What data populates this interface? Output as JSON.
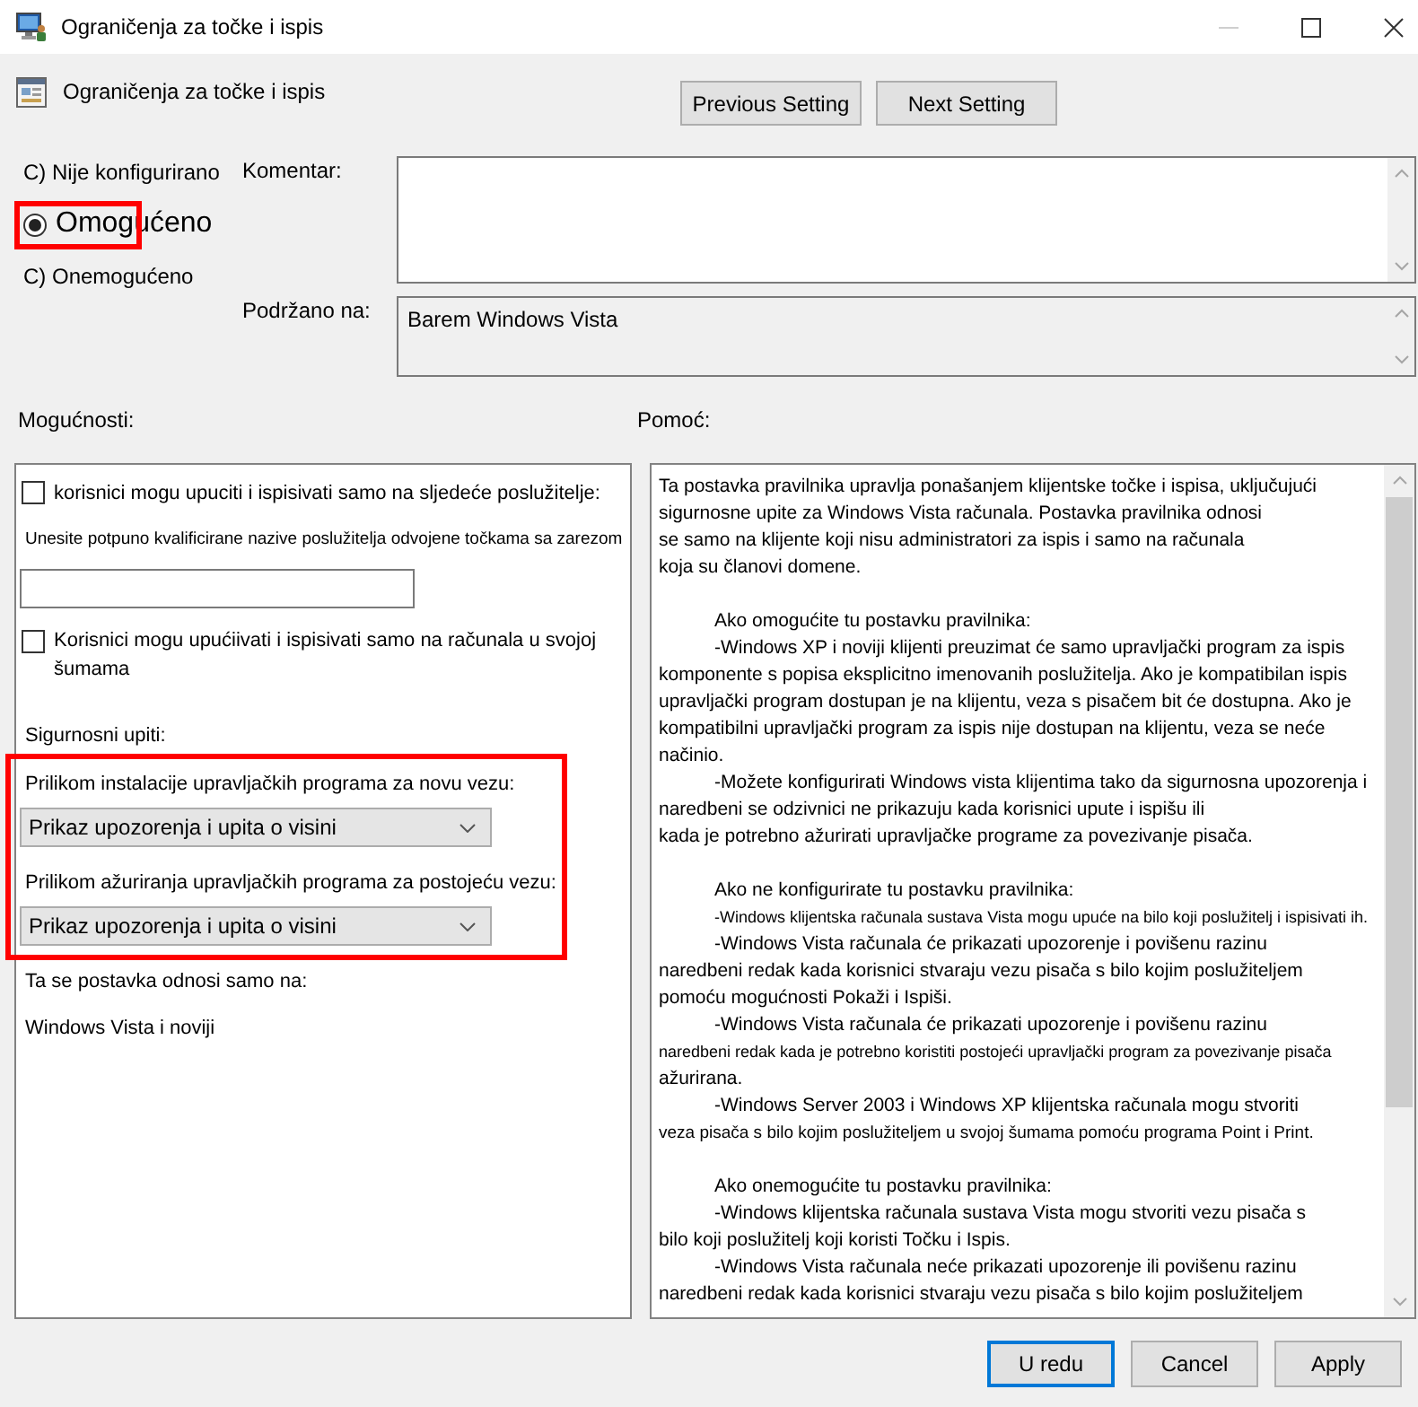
{
  "window": {
    "title": "Ograničenja za točke i ispis"
  },
  "header": {
    "title": "Ograničenja za točke i ispis",
    "nav_buttons": [
      {
        "label": "Previous Setting"
      },
      {
        "label": "Next Setting"
      }
    ]
  },
  "state_options": [
    {
      "label": "C) Nije konfigurirano",
      "selected": false,
      "highlighted": false
    },
    {
      "label": "Omogućeno",
      "selected": true,
      "highlighted": true
    },
    {
      "label": "C) Onemogućeno",
      "selected": false,
      "highlighted": false
    }
  ],
  "comment": {
    "label": "Komentar:"
  },
  "supported": {
    "label": "Podržano na:",
    "value": "Barem Windows Vista"
  },
  "options": {
    "title": "Mogućnosti:",
    "allowed_servers": {
      "label": "korisnici mogu upuciti i ispisivati samo na sljedeće poslužitelje:",
      "checked": false,
      "hint": "Unesite potpuno kvalificirane nazive poslužitelja odvojene točkama sa zarezom"
    },
    "forest_only": {
      "label": "Korisnici mogu upućiivati i ispisivati samo na računala u svojoj šumama",
      "checked": false
    },
    "security_prompts": {
      "title": "Sigurnosni upiti:",
      "highlighted": true,
      "fields": [
        {
          "label": "Prilikom instalacije upravljačkih programa za novu vezu:",
          "value": "Prikaz upozorenja i upita o visini"
        },
        {
          "label": "Prilikom ažuriranja upravljačkih programa za postojeću vezu:",
          "value": "Prikaz upozorenja i upita o visini"
        }
      ]
    },
    "applies_to": {
      "label": "Ta se postavka odnosi samo na:",
      "value": "Windows Vista i noviji"
    }
  },
  "help": {
    "title": "Pomoć:",
    "sections": [
      {
        "items": [
          {
            "indented": false,
            "lines": [
              {
                "text": "Ta postavka pravilnika upravlja ponašanjem klijentske točke i ispisa, uključujući",
                "kind": "normal"
              },
              {
                "text": "sigurnosne upite za Windows Vista računala. Postavka pravilnika odnosi",
                "kind": "normal"
              },
              {
                "text": "se samo na klijente koji nisu administratori za ispis i samo na računala",
                "kind": "normal"
              },
              {
                "text": "koja su članovi domene.",
                "kind": "normal"
              }
            ]
          }
        ]
      },
      {
        "items": [
          {
            "indented": true,
            "lines": [
              {
                "text": "Ako omogućite tu postavku pravilnika:",
                "kind": "normal"
              }
            ]
          },
          {
            "indented": true,
            "lines": [
              {
                "text": "-Windows XP i noviji klijenti preuzimat će samo upravljački program za ispis",
                "kind": "normal"
              },
              {
                "text": "komponente s popisa eksplicitno imenovanih poslužitelja. Ako je kompatibilan ispis",
                "kind": "normal"
              },
              {
                "text": "upravljački program dostupan je na klijentu, veza s pisačem bit će dostupna. Ako je",
                "kind": "normal"
              },
              {
                "text": "kompatibilni upravljački program za ispis nije dostupan na klijentu, veza se neće",
                "kind": "normal"
              },
              {
                "text": "načinio.",
                "kind": "normal"
              }
            ]
          },
          {
            "indented": true,
            "lines": [
              {
                "text": "-Možete konfigurirati Windows vista klijentima tako da sigurnosna upozorenja i",
                "kind": "normal"
              },
              {
                "text": "naredbeni se odzivnici ne prikazuju kada korisnici upute i ispišu ili",
                "kind": "normal"
              },
              {
                "text": "kada je potrebno ažurirati upravljačke programe za povezivanje pisača.",
                "kind": "normal"
              }
            ]
          }
        ]
      },
      {
        "items": [
          {
            "indented": true,
            "lines": [
              {
                "text": "Ako ne konfigurirate tu postavku pravilnika:",
                "kind": "normal"
              }
            ]
          },
          {
            "indented": true,
            "lines": [
              {
                "text": "-Windows klijentska računala sustava Vista mogu upuće na bilo koji poslužitelj i ispisivati ih.",
                "kind": "tiny"
              }
            ]
          },
          {
            "indented": true,
            "lines": [
              {
                "text": "-Windows Vista računala će prikazati upozorenje i povišenu razinu",
                "kind": "normal"
              },
              {
                "text": "naredbeni redak kada korisnici stvaraju vezu pisača s bilo kojim poslužiteljem",
                "kind": "normal"
              },
              {
                "text": "pomoću mogućnosti Pokaži i Ispiši.",
                "kind": "normal"
              }
            ]
          },
          {
            "indented": true,
            "lines": [
              {
                "text": "-Windows Vista računala će prikazati upozorenje i povišenu razinu",
                "kind": "normal"
              },
              {
                "text": "naredbeni redak kada je potrebno koristiti postojeći upravljački program za povezivanje pisača",
                "kind": "tiny"
              },
              {
                "text": "ažurirana.",
                "kind": "normal"
              }
            ]
          },
          {
            "indented": true,
            "lines": [
              {
                "text": "-Windows Server 2003 i Windows XP klijentska računala mogu stvoriti",
                "kind": "normal"
              },
              {
                "text": "veza pisača s bilo kojim poslužiteljem u svojoj šumama pomoću programa Point i Print.",
                "kind": "small"
              }
            ]
          }
        ]
      },
      {
        "items": [
          {
            "indented": true,
            "lines": [
              {
                "text": "Ako onemogućite tu postavku pravilnika:",
                "kind": "normal"
              }
            ]
          },
          {
            "indented": true,
            "lines": [
              {
                "text": "-Windows klijentska računala sustava Vista mogu stvoriti vezu pisača s",
                "kind": "normal"
              },
              {
                "text": "bilo koji poslužitelj koji koristi Točku i Ispis.",
                "kind": "normal"
              }
            ]
          },
          {
            "indented": true,
            "lines": [
              {
                "text": "-Windows Vista računala neće prikazati upozorenje ili povišenu razinu",
                "kind": "normal"
              },
              {
                "text": "naredbeni redak kada korisnici stvaraju vezu pisača s bilo kojim poslužiteljem",
                "kind": "normal"
              }
            ]
          }
        ]
      }
    ]
  },
  "buttons": [
    {
      "label": "U redu",
      "default": true
    },
    {
      "label": "Cancel",
      "default": false
    },
    {
      "label": "Apply",
      "default": false
    }
  ]
}
